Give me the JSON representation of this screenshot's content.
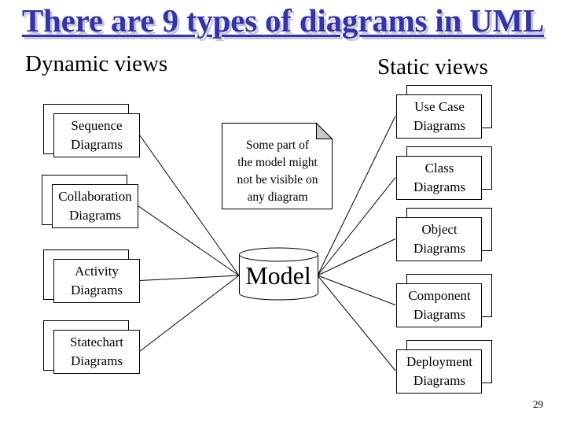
{
  "title": "There are 9 types of diagrams in UML",
  "groups": {
    "dynamic": "Dynamic views",
    "static": "Static views"
  },
  "dynamic_diagrams": [
    {
      "label": "Sequence\nDiagrams"
    },
    {
      "label": "Collaboration\nDiagrams"
    },
    {
      "label": "Activity\nDiagrams"
    },
    {
      "label": "Statechart\nDiagrams"
    }
  ],
  "static_diagrams": [
    {
      "label": "Use Case\nDiagrams"
    },
    {
      "label": "Class\nDiagrams"
    },
    {
      "label": "Object\nDiagrams"
    },
    {
      "label": "Component\nDiagrams"
    },
    {
      "label": "Deployment\nDiagrams"
    }
  ],
  "note": "Some part of\nthe model might\nnot be visible on\nany diagram",
  "model": "Model",
  "page_number": "29",
  "colors": {
    "title": "#3333aa",
    "title_shadow": "#c8c8d8",
    "note_fold": "#c8c8c8",
    "stroke": "#000000"
  }
}
